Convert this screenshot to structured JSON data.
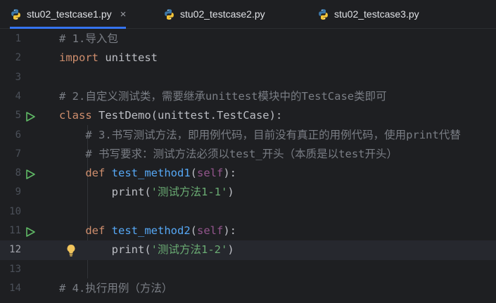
{
  "tabs": [
    {
      "label": "stu02_testcase1.py",
      "active": true,
      "close": "×"
    },
    {
      "label": "stu02_testcase2.py",
      "active": false
    },
    {
      "label": "stu02_testcase3.py",
      "active": false
    }
  ],
  "colors": {
    "background": "#1e1f22",
    "keyword": "#cf8e6d",
    "comment": "#7a7e85",
    "function": "#56a8f5",
    "self": "#94558d",
    "string": "#6aab73",
    "text": "#bcbec4",
    "run_icon": "#5fb865",
    "tab_underline": "#3574f0"
  },
  "editor": {
    "current_line": 12,
    "lines": [
      {
        "num": "1",
        "parts": [
          {
            "t": "# 1.导入包",
            "c": "cm"
          }
        ]
      },
      {
        "num": "2",
        "parts": [
          {
            "t": "import",
            "c": "kw"
          },
          {
            "t": " unittest",
            "c": ""
          }
        ]
      },
      {
        "num": "3",
        "parts": []
      },
      {
        "num": "4",
        "parts": [
          {
            "t": "# 2.自定义测试类，需要继承unittest模块中的TestCase类即可",
            "c": "cm"
          }
        ]
      },
      {
        "num": "5",
        "run": true,
        "parts": [
          {
            "t": "class",
            "c": "kw"
          },
          {
            "t": " TestDemo(unittest.TestCase):",
            "c": ""
          }
        ]
      },
      {
        "num": "6",
        "parts": [
          {
            "t": "    # 3.书写测试方法，即用例代码，目前没有真正的用例代码，使用print代替",
            "c": "cm"
          }
        ]
      },
      {
        "num": "7",
        "parts": [
          {
            "t": "    # 书写要求：测试方法必须以test_开头（本质是以test开头）",
            "c": "cm"
          }
        ]
      },
      {
        "num": "8",
        "run": true,
        "parts": [
          {
            "t": "    ",
            "c": ""
          },
          {
            "t": "def",
            "c": "kw"
          },
          {
            "t": " ",
            "c": ""
          },
          {
            "t": "test_method1",
            "c": "fn"
          },
          {
            "t": "(",
            "c": ""
          },
          {
            "t": "self",
            "c": "slf"
          },
          {
            "t": "):",
            "c": ""
          }
        ]
      },
      {
        "num": "9",
        "parts": [
          {
            "t": "        print(",
            "c": ""
          },
          {
            "t": "'测试方法1-1'",
            "c": "str"
          },
          {
            "t": ")",
            "c": ""
          }
        ]
      },
      {
        "num": "10",
        "parts": []
      },
      {
        "num": "11",
        "run": true,
        "parts": [
          {
            "t": "    ",
            "c": ""
          },
          {
            "t": "def",
            "c": "kw"
          },
          {
            "t": " ",
            "c": ""
          },
          {
            "t": "test_method2",
            "c": "fn"
          },
          {
            "t": "(",
            "c": ""
          },
          {
            "t": "self",
            "c": "slf"
          },
          {
            "t": "):",
            "c": ""
          }
        ]
      },
      {
        "num": "12",
        "bulb": true,
        "parts": [
          {
            "t": "        print(",
            "c": ""
          },
          {
            "t": "'测试方法1-2'",
            "c": "str"
          },
          {
            "t": ")",
            "c": ""
          }
        ]
      },
      {
        "num": "13",
        "parts": []
      },
      {
        "num": "14",
        "parts": [
          {
            "t": "# 4.执行用例（方法）",
            "c": "cm"
          }
        ]
      }
    ]
  }
}
